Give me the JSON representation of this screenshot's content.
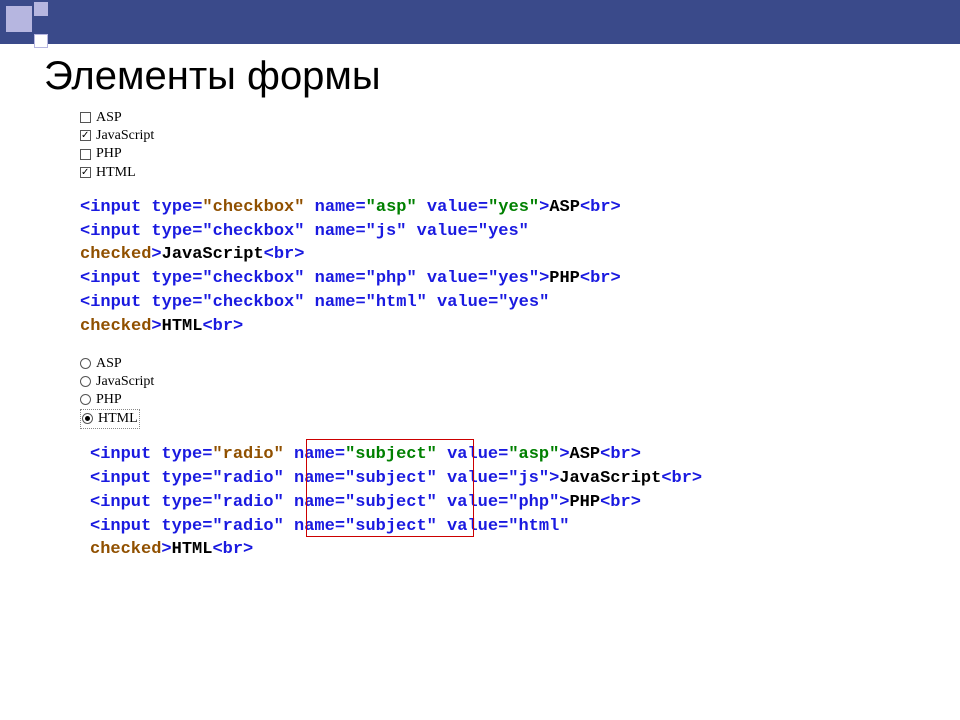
{
  "title": "Элементы формы",
  "checkbox_preview": [
    {
      "label": "ASP",
      "checked": false
    },
    {
      "label": "JavaScript",
      "checked": true
    },
    {
      "label": "PHP",
      "checked": false
    },
    {
      "label": "HTML",
      "checked": true
    }
  ],
  "radio_preview": [
    {
      "label": "ASP",
      "checked": false
    },
    {
      "label": "JavaScript",
      "checked": false
    },
    {
      "label": "PHP",
      "checked": false
    },
    {
      "label": "HTML",
      "checked": true,
      "focus": true
    }
  ],
  "code1": {
    "l1": {
      "open": "<input type=",
      "type": "\"checkbox\"",
      "mid": " name=",
      "name": "\"asp\"",
      "mid2": " value=",
      "val": "\"yes\"",
      "close": ">",
      "text": "ASP",
      "br": "<br>"
    },
    "l2": {
      "pre": "<input type=\"checkbox\" name=\"js\" value=\"yes\""
    },
    "l2b": {
      "checked": "checked",
      "close": ">",
      "text": "JavaScript",
      "br": "<br>"
    },
    "l3": {
      "body": "<input type=\"checkbox\" name=\"php\" value=\"yes\">",
      "text": "PHP",
      "br": "<br>"
    },
    "l4": {
      "pre": "<input type=\"checkbox\" name=\"html\" value=\"yes\""
    },
    "l4b": {
      "checked": "checked",
      "close": ">",
      "text": "HTML",
      "br": "<br>"
    }
  },
  "code2": {
    "l1": {
      "open": "<input type=",
      "type": "\"radio\"",
      "mid": " name=",
      "name": "\"subject\"",
      "mid2": " value=",
      "val": "\"asp\"",
      "close": ">",
      "text": "ASP",
      "br": "<br>"
    },
    "l2": {
      "pre": "<input type=\"radio\" name=\"subject\" value=\"js\">",
      "text": "JavaScript",
      "br": "<br>"
    },
    "l3": {
      "pre": "<input type=\"radio\" name=\"subject\" value=\"php\">",
      "text": "PHP",
      "br": "<br>"
    },
    "l4": {
      "pre": "<input type=\"radio\" name=\"subject\" value=\"html\""
    },
    "l4b": {
      "checked": "checked",
      "close": ">",
      "text": "HTML",
      "br": "<br>"
    }
  }
}
